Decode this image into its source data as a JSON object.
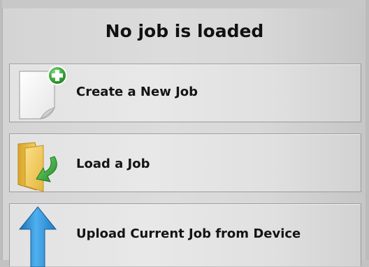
{
  "header": {
    "title": "No job is loaded"
  },
  "buttons": [
    {
      "label": "Create a New Job",
      "icon": "new-document-plus-icon"
    },
    {
      "label": "Load a Job",
      "icon": "folder-load-icon"
    },
    {
      "label": "Upload Current Job from Device",
      "icon": "upload-arrow-icon"
    }
  ],
  "colors": {
    "plus_green": "#3aa53a",
    "load_arrow_green": "#2e9e2e",
    "folder_yellow": "#f0c84a",
    "upload_blue": "#2a8fd6"
  }
}
